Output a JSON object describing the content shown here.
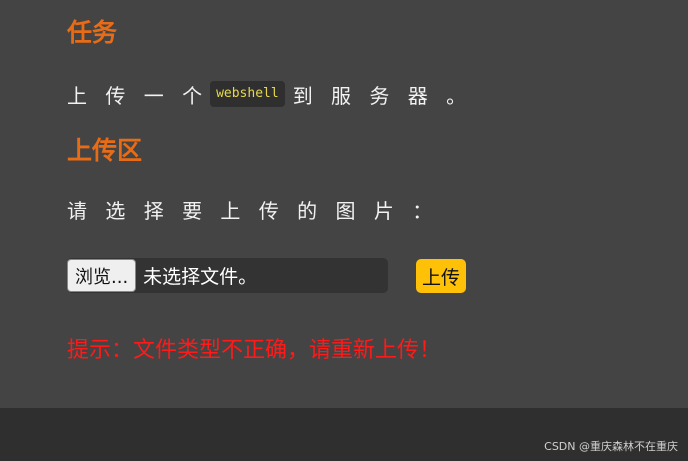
{
  "task": {
    "heading": "任务",
    "text_before": "上 传 一 个",
    "code": "webshell",
    "text_after": "到 服 务 器 。"
  },
  "upload": {
    "heading": "上传区",
    "prompt": "请 选 择 要 上 传 的 图 片 ：",
    "browse_label": "浏览...",
    "file_status": "未选择文件。",
    "upload_label": "上传"
  },
  "hint": {
    "text": "提示：文件类型不正确，请重新上传！",
    "color": "#ff1a1a"
  },
  "footer": {
    "watermark": "CSDN @重庆森林不在重庆"
  },
  "colors": {
    "heading": "#e86b16",
    "background": "#444444",
    "footer": "#2f2f2f",
    "upload_button": "#ffc107"
  }
}
